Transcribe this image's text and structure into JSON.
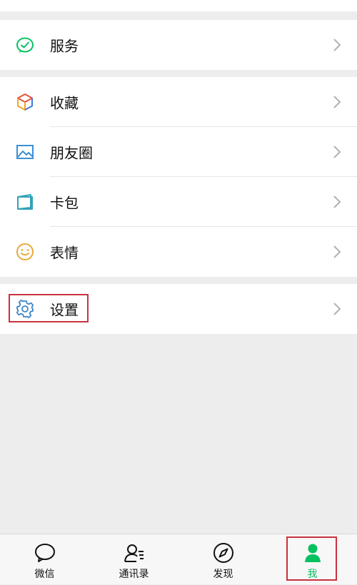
{
  "groups": {
    "services": {
      "label": "服务"
    },
    "main": {
      "items": [
        {
          "label": "收藏"
        },
        {
          "label": "朋友圈"
        },
        {
          "label": "卡包"
        },
        {
          "label": "表情"
        }
      ]
    },
    "settings": {
      "label": "设置"
    }
  },
  "tabbar": {
    "tabs": [
      {
        "label": "微信"
      },
      {
        "label": "通讯录"
      },
      {
        "label": "发现"
      },
      {
        "label": "我"
      }
    ]
  },
  "colors": {
    "accent": "#07c160",
    "highlight_box": "#c8323c"
  }
}
